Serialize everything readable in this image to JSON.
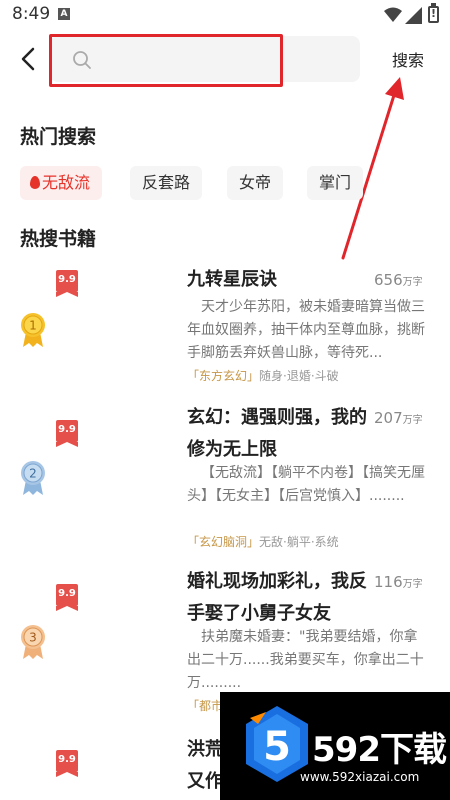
{
  "status": {
    "time": "8:49",
    "notif_letter": "A"
  },
  "search": {
    "placeholder": "",
    "value": "",
    "button_label": "搜索"
  },
  "hot_search": {
    "title": "热门搜索",
    "tags": [
      {
        "label": "无敌流",
        "active": true
      },
      {
        "label": "反套路",
        "active": false
      },
      {
        "label": "女帝",
        "active": false
      },
      {
        "label": "掌门",
        "active": false
      }
    ]
  },
  "hot_books": {
    "title": "热搜书籍",
    "books": [
      {
        "score": "9.9",
        "rank": "1",
        "title": "九转星辰诀",
        "words": "656",
        "unit": "万字",
        "desc": "天才少年苏阳，被未婚妻暗算当做三年血奴圈养，抽干体内至尊血脉，挑断手脚筋丢弃妖兽山脉，等待死...",
        "genre": "「东方玄幻」",
        "tags": "随身·退婚·斗破"
      },
      {
        "score": "9.9",
        "rank": "2",
        "title": "玄幻：遇强则强，我的修为无上限",
        "words": "207",
        "unit": "万字",
        "desc": "【无敌流】【躺平不内卷】【搞笑无厘头】【无女主】【后宫党慎入】........",
        "genre": "「玄幻脑洞」",
        "tags": "无敌·躺平·系统"
      },
      {
        "score": "9.9",
        "rank": "3",
        "title": "婚礼现场加彩礼，我反手娶了小舅子女友",
        "words": "116",
        "unit": "万字",
        "desc": "扶弟魔未婚妻：\"我弟要结婚，你拿出二十万......我弟要买车，你拿出二十万.........",
        "genre": "「都市",
        "tags": ""
      },
      {
        "score": "9.9",
        "rank": "",
        "title": "洪荒\n又作",
        "words": "",
        "unit": "",
        "desc": "",
        "genre": "",
        "tags": ""
      }
    ]
  },
  "watermark": {
    "brand": "592下载",
    "url": "www.592xiazai.com"
  },
  "colors": {
    "accent": "#e5332a",
    "annotation_red": "#e0262b",
    "genre_gold": "#c69748",
    "badge_red": "#e5504a"
  }
}
